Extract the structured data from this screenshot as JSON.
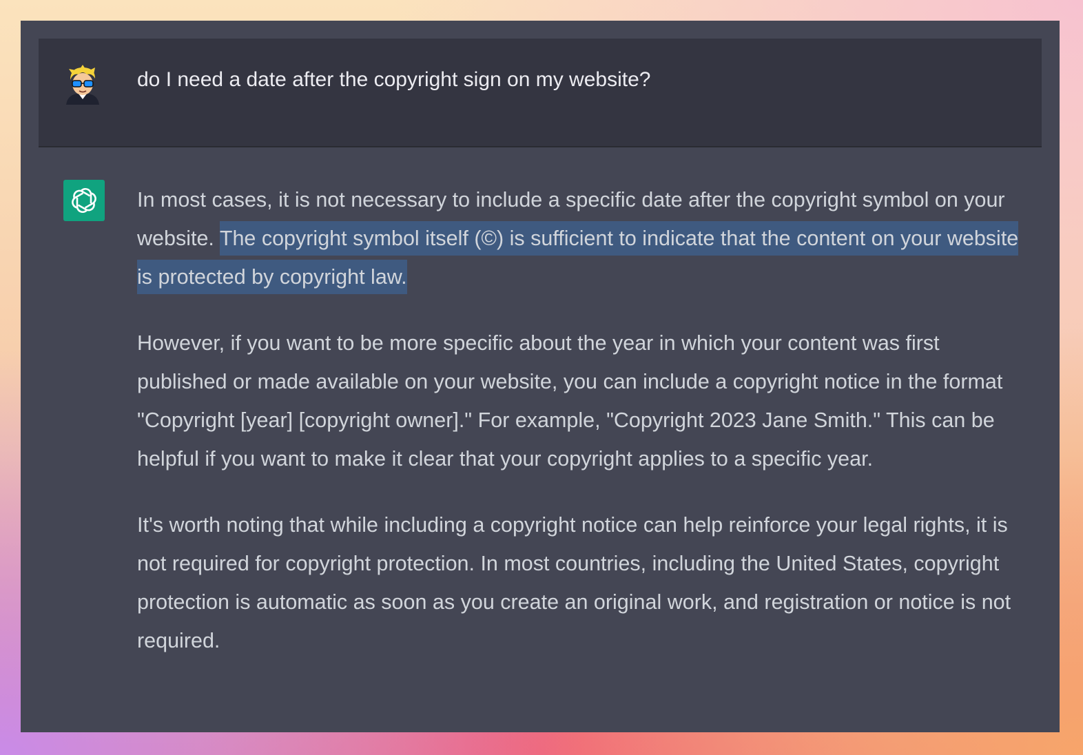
{
  "conversation": {
    "user_message": {
      "avatar_icon": "user-avatar-cartoon-icon",
      "text": "do I need a date after the copyright sign on my website?"
    },
    "assistant_message": {
      "avatar_icon": "chatgpt-logo-icon",
      "avatar_color": "#10a37f",
      "paragraph1": {
        "plain": "In most cases, it is not necessary to include a specific date after the copyright symbol on your website. ",
        "highlighted": "The copyright symbol itself (©) is sufficient to indicate that the content on your website is protected by copyright law."
      },
      "paragraph2": "However, if you want to be more specific about the year in which your content was first published or made available on your website, you can include a copyright notice in the format \"Copyright [year] [copyright owner].\" For example, \"Copyright 2023 Jane Smith.\" This can be helpful if you want to make it clear that your copyright applies to a specific year.",
      "paragraph3": "It's worth noting that while including a copyright notice can help reinforce your legal rights, it is not required for copyright protection. In most countries, including the United States, copyright protection is automatic as soon as you create an original work, and registration or notice is not required."
    }
  },
  "colors": {
    "window_bg": "#444654",
    "user_row_bg": "#343541",
    "selection_highlight": "#3f5a80",
    "assistant_text": "#d1d5db",
    "user_text": "#ececf1"
  }
}
